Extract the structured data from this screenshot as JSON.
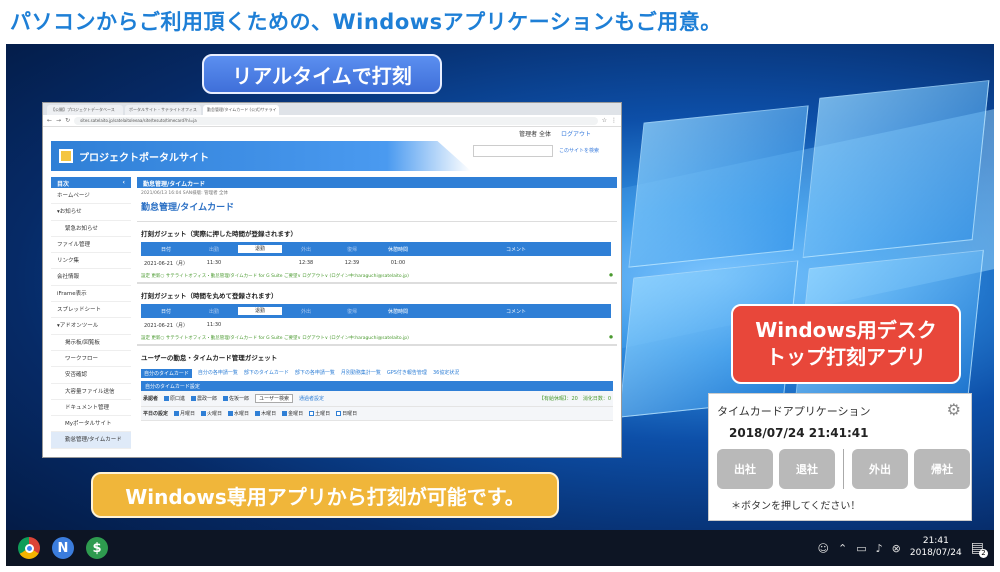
{
  "headline": "パソコンからご利用頂くための、Windowsアプリケーションもご用意。",
  "callouts": {
    "realtime": "リアルタイムで打刻",
    "desktop_line1": "Windows用デスク",
    "desktop_line2": "トップ打刻アプリ",
    "windows_only": "Windows専用アプリから打刻が可能です。"
  },
  "browser": {
    "tabs": [
      "【公開】プロジェクトデータベース",
      "ポータルサイト - サテライトオフィス",
      "勤怠管理/タイムカード (公式)サテライ"
    ],
    "url": "sites.satelaito.jp/satelaitoleeaa/site/tesuto/timecard?hl=ja",
    "user_label": "管理者 全体",
    "logout": "ログアウト",
    "site_title": "プロジェクトポータルサイト",
    "site_search_option": "このサイトを検索",
    "sidebar": {
      "head": "目次",
      "items": [
        "ホームページ",
        "▾お知らせ",
        "緊急お知らせ",
        "ファイル管理",
        "リンク集",
        "会社情報",
        "iFrame表示",
        "スプレッドシート",
        "▾アドオンツール",
        "掲示板/回覧板",
        "ワークフロー",
        "安否確認",
        "大容量ファイル送信",
        "ドキュメント管理",
        "Myポータルサイト",
        "勤怠管理/タイムカード"
      ]
    },
    "content": {
      "head": "勤怠管理/タイムカード",
      "meta": "2021/06/13 16:04 SAN様版: 管理者 全体",
      "title": "勤怠管理/タイムカード",
      "gadget1_title": "打刻ガジェット（実際に押した時間が登録されます）",
      "gadget2_title": "打刻ガジェット（時間を丸めて登録されます）",
      "columns": [
        "日付",
        "出勤",
        "退勤",
        "外出",
        "復帰",
        "休憩時間",
        "コメント"
      ],
      "row1": [
        "2021-06-21（月）",
        "11:30",
        "",
        "12:38",
        "12:39",
        "01:00",
        ""
      ],
      "row2": [
        "2021-06-21（月）",
        "11:30",
        "",
        "",
        "",
        "",
        ""
      ],
      "footer": "設定 更新○ サテライトオフィス・勤怠管理/タイムカード for G Suite ご要望∨ ログアウト∨ (ログイン中:haraguchi@satelaito.jp)",
      "user_gadget_title": "ユーザーの勤怠・タイムカード管理ガジェット",
      "ug_tabs": [
        "自分のタイムカード",
        "自分の各申請一覧",
        "部下のタイムカード",
        "部下の各申請一覧",
        "月別勤務集計一覧",
        "GPS付き報告管理",
        "36協定状況"
      ],
      "ug_bar": "自分のタイムカード設定",
      "ug_row1": [
        "承認者",
        "原口進",
        "農政一郎",
        "佐坂一郎",
        "ユーザー検索",
        "通過者設定",
        "【有給休暇】：20　消化日数：0"
      ],
      "ug_row2": [
        "平日の設定",
        "月曜日",
        "火曜日",
        "水曜日",
        "木曜日",
        "金曜日",
        "土曜日",
        "日曜日"
      ]
    }
  },
  "timecard_app": {
    "title": "タイムカードアプリケーション",
    "datetime": "2018/07/24 21:41:41",
    "buttons": [
      "出社",
      "退社",
      "外出",
      "帰社"
    ],
    "note": "＊ボタンを押してください！"
  },
  "taskbar": {
    "time": "21:41",
    "date": "2018/07/24",
    "notifications": "2"
  },
  "colors": {
    "headline": "#1e7fd6",
    "callout_blue": "#3f6fd9",
    "callout_red": "#e8473a",
    "callout_yellow": "#f0b63a"
  }
}
